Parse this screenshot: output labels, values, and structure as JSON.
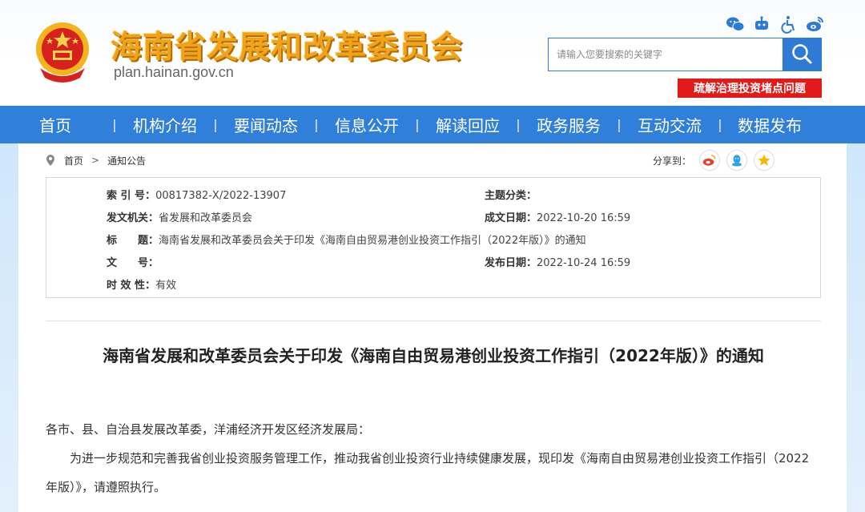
{
  "header": {
    "site_title": "海南省发展和改革委员会",
    "site_url": "plan.hainan.gov.cn",
    "icons": [
      "wechat-icon",
      "robot-icon",
      "accessibility-icon",
      "weibo-icon"
    ],
    "search": {
      "placeholder": "请输入您要搜索的关键字"
    },
    "promo_banner": "疏解治理投资堵点问题"
  },
  "nav": {
    "items": [
      {
        "label": "首页"
      },
      {
        "label": "机构介绍"
      },
      {
        "label": "要闻动态"
      },
      {
        "label": "信息公开"
      },
      {
        "label": "解读回应"
      },
      {
        "label": "政务服务"
      },
      {
        "label": "互动交流"
      },
      {
        "label": "数据发布"
      }
    ],
    "separator": "|"
  },
  "breadcrumb": {
    "home": "首页",
    "separator": ">",
    "current": "通知公告"
  },
  "share": {
    "label": "分享到：",
    "targets": [
      "weibo-icon",
      "qq-icon",
      "qzone-icon"
    ]
  },
  "info": {
    "index_no_label": "索 引 号：",
    "index_no": "00817382-X/2022-13907",
    "topic_label": "主题分类：",
    "topic": "",
    "issuer_label": "发文机关：",
    "issuer": "省发展和改革委员会",
    "created_label": "成文日期：",
    "created": "2022-10-20 16:59",
    "title_label": "标　　题：",
    "title": "海南省发展和改革委员会关于印发《海南自由贸易港创业投资工作指引（2022年版）》的通知",
    "doc_no_label": "文　　号：",
    "doc_no": "",
    "published_label": "发布日期：",
    "published": "2022-10-24 16:59",
    "validity_label": "时 效 性：",
    "validity": "有效"
  },
  "article": {
    "title": "海南省发展和改革委员会关于印发《海南自由贸易港创业投资工作指引（2022年版）》的通知",
    "salutation": "各市、县、自治县发展改革委，洋浦经济开发区经济发展局：",
    "body_line1": "为进一步规范和完善我省创业投资服务管理工作，推动我省创业投资行业持续健康发展，现印发《海南自由贸易港创业投资工作指引（2022",
    "body_line2": "年版）》，请遵照执行。"
  },
  "colors": {
    "primary_blue": "#2f7fdb",
    "title_gold": "#f0a21a",
    "banner_red": "#e21a1a"
  }
}
